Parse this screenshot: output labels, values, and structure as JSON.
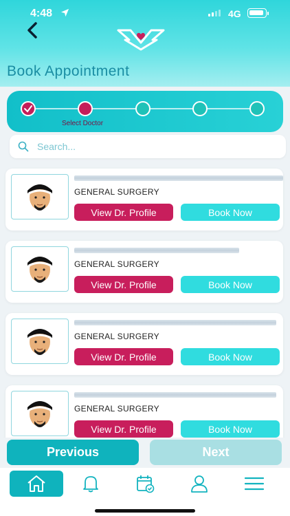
{
  "status_bar": {
    "time": "4:48",
    "network": "4G"
  },
  "header": {
    "title": "Book Appointment"
  },
  "stepper": {
    "current_step_label": "Select Doctor",
    "total_steps": 5,
    "current_step": 2
  },
  "search": {
    "placeholder": "Search..."
  },
  "doctors": [
    {
      "specialty": "GENERAL SURGERY",
      "profile_label": "View Dr. Profile",
      "book_label": "Book Now"
    },
    {
      "specialty": "GENERAL SURGERY",
      "profile_label": "View Dr. Profile",
      "book_label": "Book Now"
    },
    {
      "specialty": "GENERAL SURGERY",
      "profile_label": "View Dr. Profile",
      "book_label": "Book Now"
    },
    {
      "specialty": "GENERAL SURGERY",
      "profile_label": "View Dr. Profile",
      "book_label": "Book Now"
    }
  ],
  "nav": {
    "previous_label": "Previous",
    "next_label": "Next"
  },
  "tabbar": {
    "items": [
      "home-icon",
      "bell-icon",
      "calendar-check-icon",
      "user-icon",
      "menu-icon"
    ]
  },
  "colors": {
    "accent": "#0fb3bd",
    "brand_pink": "#c81e5c",
    "book_button": "#30dcdf"
  }
}
